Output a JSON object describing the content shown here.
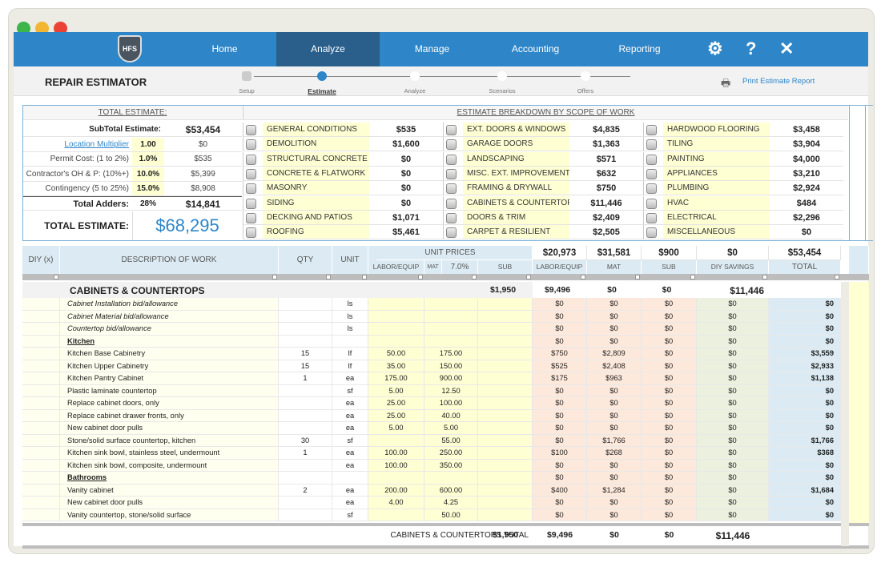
{
  "window": {
    "dots": [
      "#3cb54a",
      "#f2b632",
      "#ea4335"
    ]
  },
  "nav": {
    "logo": "HFS",
    "tabs": [
      "Home",
      "Analyze",
      "Manage",
      "Accounting",
      "Reporting"
    ],
    "active": "Analyze",
    "icons": [
      "gear-icon",
      "help-icon",
      "close-icon"
    ]
  },
  "header": {
    "title": "REPAIR ESTIMATOR",
    "steps": [
      "Setup",
      "Estimate",
      "Analyze",
      "Scenarios",
      "Offers"
    ],
    "active_step": "Estimate",
    "print_label": "Print Estimate Report"
  },
  "summary": {
    "title": "TOTAL ESTIMATE:",
    "subtotal_label": "SubTotal Estimate:",
    "subtotal": "$53,454",
    "rows": [
      {
        "label": "Location Multiplier",
        "rate": "1.00",
        "value": "$0"
      },
      {
        "label": "Permit Cost: (1 to 2%)",
        "rate": "1.0%",
        "value": "$535"
      },
      {
        "label": "Contractor's  OH & P: (10%+)",
        "rate": "10.0%",
        "value": "$5,399"
      },
      {
        "label": "Contingency (5 to 25%)",
        "rate": "15.0%",
        "value": "$8,908"
      }
    ],
    "adders_label": "Total Adders:",
    "adders_pct": "28%",
    "adders": "$14,841",
    "total_label": "TOTAL ESTIMATE:",
    "total": "$68,295"
  },
  "breakdown": {
    "title": "ESTIMATE BREAKDOWN BY SCOPE OF WORK",
    "groups": [
      [
        [
          "GENERAL CONDITIONS",
          "$535"
        ],
        [
          "DEMOLITION",
          "$1,600"
        ],
        [
          "STRUCTURAL CONCRETE",
          "$0"
        ],
        [
          "CONCRETE & FLATWORK",
          "$0"
        ],
        [
          "MASONRY",
          "$0"
        ],
        [
          "SIDING",
          "$0"
        ],
        [
          "DECKING AND PATIOS",
          "$1,071"
        ],
        [
          "ROOFING",
          "$5,461"
        ]
      ],
      [
        [
          "EXT. DOORS & WINDOWS",
          "$4,835"
        ],
        [
          "GARAGE DOORS",
          "$1,363"
        ],
        [
          "LANDSCAPING",
          "$571"
        ],
        [
          "MISC. EXT. IMPROVEMENTS",
          "$632"
        ],
        [
          "FRAMING & DRYWALL",
          "$750"
        ],
        [
          "CABINETS & COUNTERTOPS",
          "$11,446"
        ],
        [
          "DOORS & TRIM",
          "$2,409"
        ],
        [
          "CARPET & RESILIENT",
          "$2,505"
        ]
      ],
      [
        [
          "HARDWOOD FLOORING",
          "$3,458"
        ],
        [
          "TILING",
          "$3,904"
        ],
        [
          "PAINTING",
          "$4,000"
        ],
        [
          "APPLIANCES",
          "$3,210"
        ],
        [
          "PLUMBING",
          "$2,924"
        ],
        [
          "HVAC",
          "$484"
        ],
        [
          "ELECTRICAL",
          "$2,296"
        ],
        [
          "MISCELLANEOUS",
          "$0"
        ]
      ]
    ]
  },
  "table": {
    "headers": {
      "diy": "DIY (x)",
      "desc": "DESCRIPTION OF WORK",
      "qty": "QTY",
      "unit": "UNIT",
      "unit_prices": "UNIT PRICES",
      "labor": "LABOR/EQUIP",
      "mat": "MAT",
      "mat_pct": "7.0%",
      "sub": "SUB",
      "t_labor": "LABOR/EQUIP",
      "t_mat": "MAT",
      "t_sub": "SUB",
      "t_diy": "DIY SAVINGS",
      "t_total": "TOTAL"
    },
    "totals": [
      "$20,973",
      "$31,581",
      "$900",
      "$0",
      "$53,454"
    ],
    "section": {
      "title": "CABINETS & COUNTERTOPS",
      "values": [
        "$1,950",
        "$9,496",
        "$0",
        "$0",
        "$11,446"
      ]
    },
    "rows": [
      {
        "d": "Cabinet Installation bid/allowance",
        "i": true,
        "q": "",
        "u": "ls",
        "l": "",
        "m": "",
        "s": "",
        "v": [
          "$0",
          "$0",
          "$0",
          "$0",
          "$0"
        ]
      },
      {
        "d": "Cabinet Material bid/allowance",
        "i": true,
        "q": "",
        "u": "ls",
        "l": "",
        "m": "",
        "s": "",
        "v": [
          "$0",
          "$0",
          "$0",
          "$0",
          "$0"
        ]
      },
      {
        "d": "Countertop bid/allowance",
        "i": true,
        "q": "",
        "u": "ls",
        "l": "",
        "m": "",
        "s": "",
        "v": [
          "$0",
          "$0",
          "$0",
          "$0",
          "$0"
        ]
      },
      {
        "d": "Kitchen",
        "h": true,
        "q": "",
        "u": "",
        "l": "",
        "m": "",
        "s": "",
        "v": [
          "$0",
          "$0",
          "$0",
          "$0",
          "$0"
        ]
      },
      {
        "d": "Kitchen Base Cabinetry",
        "q": "15",
        "u": "lf",
        "l": "50.00",
        "m": "175.00",
        "s": "",
        "v": [
          "$750",
          "$2,809",
          "$0",
          "$0",
          "$3,559"
        ]
      },
      {
        "d": "Kitchen Upper Cabinetry",
        "q": "15",
        "u": "lf",
        "l": "35.00",
        "m": "150.00",
        "s": "",
        "v": [
          "$525",
          "$2,408",
          "$0",
          "$0",
          "$2,933"
        ]
      },
      {
        "d": "Kitchen Pantry Cabinet",
        "q": "1",
        "u": "ea",
        "l": "175.00",
        "m": "900.00",
        "s": "",
        "v": [
          "$175",
          "$963",
          "$0",
          "$0",
          "$1,138"
        ]
      },
      {
        "d": "Plastic laminate countertop",
        "q": "",
        "u": "sf",
        "l": "5.00",
        "m": "12.50",
        "s": "",
        "v": [
          "$0",
          "$0",
          "$0",
          "$0",
          "$0"
        ]
      },
      {
        "d": "Replace cabinet doors, only",
        "q": "",
        "u": "ea",
        "l": "25.00",
        "m": "100.00",
        "s": "",
        "v": [
          "$0",
          "$0",
          "$0",
          "$0",
          "$0"
        ]
      },
      {
        "d": "Replace cabinet drawer fronts, only",
        "q": "",
        "u": "ea",
        "l": "25.00",
        "m": "40.00",
        "s": "",
        "v": [
          "$0",
          "$0",
          "$0",
          "$0",
          "$0"
        ]
      },
      {
        "d": "New cabinet door pulls",
        "q": "",
        "u": "ea",
        "l": "5.00",
        "m": "5.00",
        "s": "",
        "v": [
          "$0",
          "$0",
          "$0",
          "$0",
          "$0"
        ]
      },
      {
        "d": "Stone/solid surface countertop, kitchen",
        "q": "30",
        "u": "sf",
        "l": "",
        "m": "55.00",
        "s": "",
        "v": [
          "$0",
          "$1,766",
          "$0",
          "$0",
          "$1,766"
        ]
      },
      {
        "d": "Kitchen sink bowl, stainless steel, undermount",
        "q": "1",
        "u": "ea",
        "l": "100.00",
        "m": "250.00",
        "s": "",
        "v": [
          "$100",
          "$268",
          "$0",
          "$0",
          "$368"
        ]
      },
      {
        "d": "Kitchen sink bowl, composite, undermount",
        "q": "",
        "u": "ea",
        "l": "100.00",
        "m": "350.00",
        "s": "",
        "v": [
          "$0",
          "$0",
          "$0",
          "$0",
          "$0"
        ]
      },
      {
        "d": "Bathrooms",
        "h": true,
        "q": "",
        "u": "",
        "l": "",
        "m": "",
        "s": "",
        "v": [
          "$0",
          "$0",
          "$0",
          "$0",
          "$0"
        ]
      },
      {
        "d": "Vanity cabinet",
        "q": "2",
        "u": "ea",
        "l": "200.00",
        "m": "600.00",
        "s": "",
        "v": [
          "$400",
          "$1,284",
          "$0",
          "$0",
          "$1,684"
        ]
      },
      {
        "d": "New cabinet door pulls",
        "q": "",
        "u": "ea",
        "l": "4.00",
        "m": "4.25",
        "s": "",
        "v": [
          "$0",
          "$0",
          "$0",
          "$0",
          "$0"
        ]
      },
      {
        "d": "Vanity countertop, stone/solid surface",
        "q": "",
        "u": "sf",
        "l": "",
        "m": "50.00",
        "s": "",
        "v": [
          "$0",
          "$0",
          "$0",
          "$0",
          "$0"
        ]
      }
    ],
    "footer": {
      "label": "CABINETS & COUNTERTOPS TOTAL",
      "values": [
        "$1,950",
        "$9,496",
        "$0",
        "$0",
        "$11,446"
      ]
    }
  },
  "colors": {
    "nav": "#2e86c8",
    "nav_active": "#2a5f8b",
    "total": "#2e86c8",
    "input": "#ffffd4",
    "labor": "#fde9dc",
    "diy": "#ebf1de",
    "total_col": "#dcebf3"
  }
}
